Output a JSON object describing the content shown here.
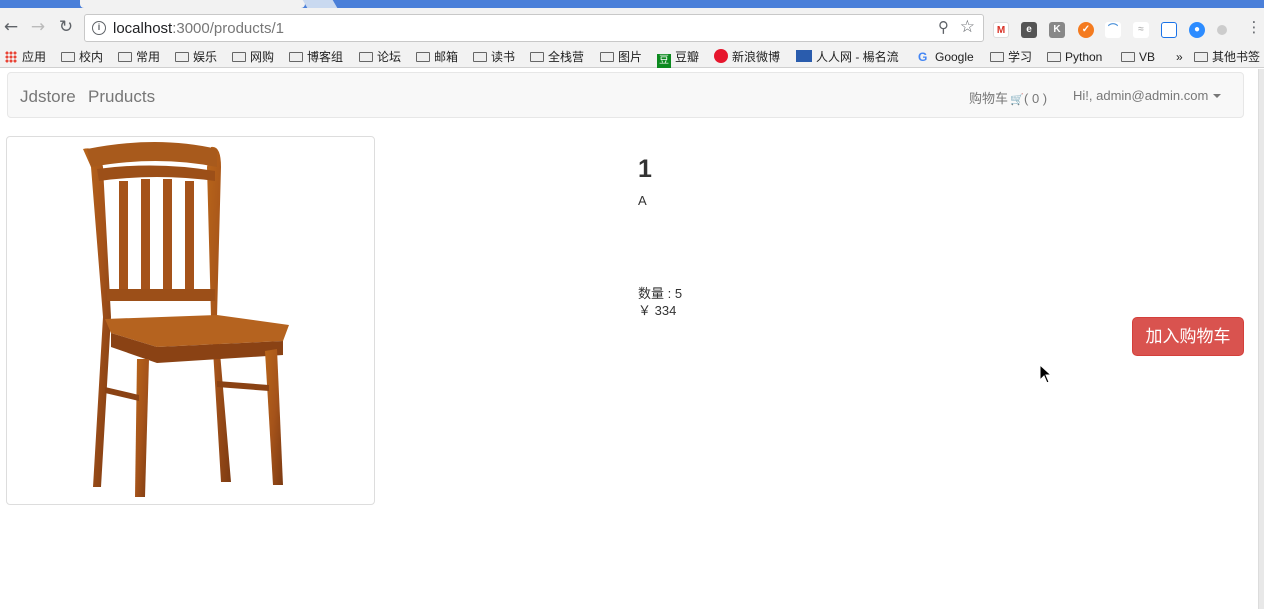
{
  "browser": {
    "url_host": "localhost",
    "url_path": ":3000/products/1",
    "bookmarks": [
      "应用",
      "校内",
      "常用",
      "娱乐",
      "网购",
      "博客组",
      "论坛",
      "邮箱",
      "读书",
      "全栈营",
      "图片",
      "豆瓣",
      "新浪微博",
      "人人网 - 楊名流",
      "Google",
      "学习",
      "Python",
      "VB",
      "»",
      "其他书签"
    ]
  },
  "navbar": {
    "brand": "Jdstore",
    "products_link": "Pruducts",
    "cart_label": "购物车",
    "cart_count": "( 0 )",
    "user_label": "Hi!, admin@admin.com"
  },
  "product": {
    "title": "1",
    "description": "A",
    "quantity": "数量 : 5",
    "price": "￥ 334",
    "add_to_cart": "加入购物车"
  }
}
